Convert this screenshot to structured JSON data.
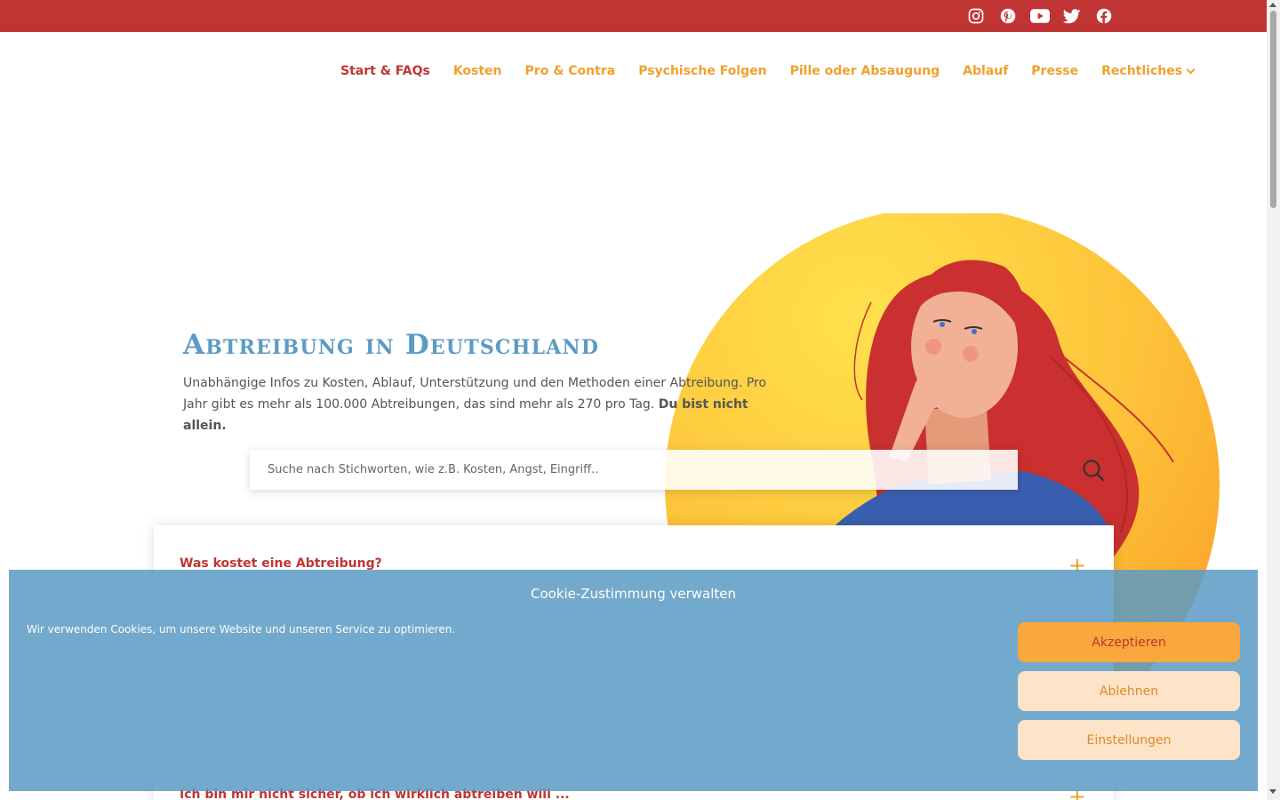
{
  "social": {
    "icons": [
      "instagram-icon",
      "pinterest-icon",
      "youtube-icon",
      "twitter-icon",
      "facebook-icon"
    ]
  },
  "nav": {
    "items": [
      {
        "label": "Start & FAQs",
        "active": true
      },
      {
        "label": "Kosten"
      },
      {
        "label": "Pro & Contra"
      },
      {
        "label": "Psychische Folgen"
      },
      {
        "label": "Pille oder Absaugung"
      },
      {
        "label": "Ablauf"
      },
      {
        "label": "Presse"
      },
      {
        "label": "Rechtliches",
        "has_dropdown": true
      }
    ]
  },
  "hero": {
    "title": "Abtreibung in Deutschland",
    "text": "Unabhängige Infos zu Kosten, Ablauf, Unterstützung und den Methoden einer Abtreibung. Pro Jahr gibt es mehr als 100.000 Abtreibungen, das sind mehr als 270 pro Tag.",
    "text_bold": "Du bist nicht allein."
  },
  "search": {
    "placeholder": "Suche nach Stichworten, wie z.B. Kosten, Angst, Eingriff.."
  },
  "faq": {
    "items": [
      {
        "question": "Was kostet eine Abtreibung?"
      },
      {
        "question": "Ich bin mir nicht sicher, ob ich wirklich abtreiben will ..."
      }
    ]
  },
  "cookie": {
    "title": "Cookie-Zustimmung verwalten",
    "text": "Wir verwenden Cookies, um unsere Website und unseren Service zu optimieren.",
    "accept": "Akzeptieren",
    "deny": "Ablehnen",
    "settings": "Einstellungen"
  },
  "colors": {
    "brand_red": "#c13434",
    "brand_orange": "#f0a02e",
    "title_blue": "#5b9bc4",
    "banner_blue": "#5b9bc4"
  }
}
